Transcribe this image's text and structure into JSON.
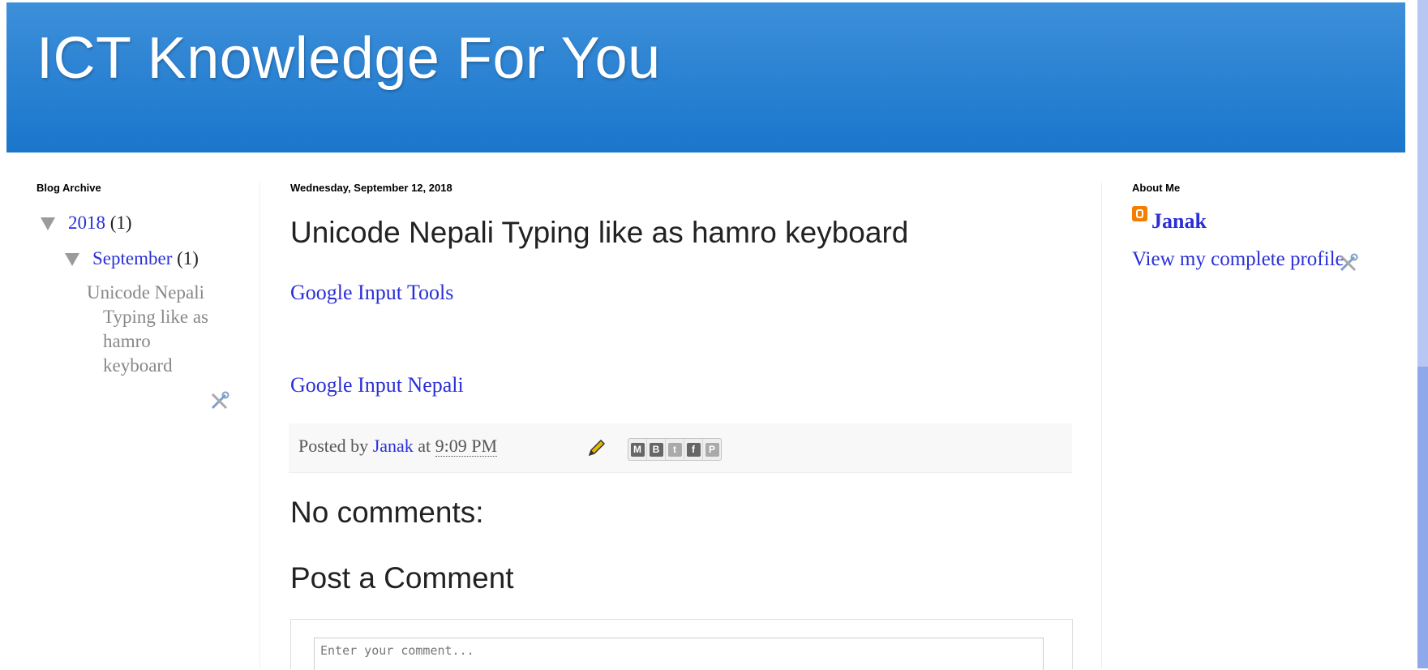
{
  "header": {
    "title": "ICT Knowledge For You"
  },
  "left_sidebar": {
    "title": "Blog Archive",
    "year": {
      "label": "2018",
      "count": "(1)"
    },
    "month": {
      "label": "September",
      "count": "(1)"
    },
    "post_lines": [
      "Unicode Nepali",
      "Typing like as",
      "hamro",
      "keyboard"
    ]
  },
  "post": {
    "date": "Wednesday, September 12, 2018",
    "title": "Unicode Nepali Typing like as hamro keyboard",
    "links": [
      "Google Input Tools",
      "Google Input Nepali"
    ],
    "footer": {
      "posted_by": "Posted by",
      "author": "Janak",
      "at": "at",
      "time": "9:09 PM"
    },
    "share_buttons": [
      "email-share",
      "blogthis-share",
      "twitter-share",
      "facebook-share",
      "pinterest-share"
    ]
  },
  "comments": {
    "heading": "No comments:",
    "post_heading": "Post a Comment",
    "placeholder": "Enter your comment..."
  },
  "right_sidebar": {
    "title": "About Me",
    "name": "Janak",
    "profile_link": "View my complete profile"
  },
  "colors": {
    "header": "#1a76cc",
    "link": "#2a2fd6",
    "blogger": "#f57d00"
  }
}
